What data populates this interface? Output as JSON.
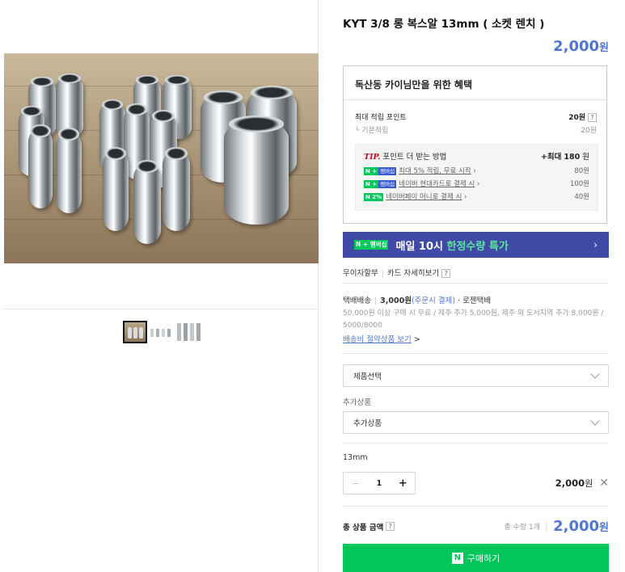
{
  "product": {
    "title": "KYT 3/8 롱 복스알 13mm ( 소켓 렌치 )",
    "price_num": "2,000",
    "price_unit": "원"
  },
  "benefits": {
    "title": "독산동 카이님만을 위한 혜택",
    "max_points_label": "최대 적립 포인트",
    "max_points_value": "20원",
    "help_glyph": "?",
    "base_label": "└ 기본적립",
    "base_value": "20원",
    "tip_prefix": "TIP.",
    "tip_title": "포인트 더 받는 방법",
    "tip_max_prefix": "+최대",
    "tip_max_value": "180",
    "tip_max_unit": "원",
    "tips": [
      {
        "badge": "N +",
        "badge2": "멤버십",
        "text": "최대 5% 적립, 무료 시작",
        "value": "80원"
      },
      {
        "badge": "N +",
        "badge2": "멤버십",
        "text": "네이버 현대카드로 결제 시",
        "value": "100원"
      },
      {
        "badge": "N 2%",
        "badge2": "",
        "text": "네이버페이 머니로 결제 시",
        "value": "40원"
      }
    ],
    "chevron": "›"
  },
  "banner": {
    "badge": "N + 멤버십",
    "text1": "매일 10시",
    "text2": "한정수량 특가",
    "arrow": "›"
  },
  "card": {
    "installment": "무이자할부",
    "card_detail": "카드 자세히보기",
    "help": "?"
  },
  "shipping": {
    "label": "택배배송",
    "fee": "3,000원",
    "fee_note": "(주문시 결제)",
    "carrier": "· 로젠택배",
    "note": "50,000원 이상 구매 시 무료 / 제주 추가 5,000원, 제주 외 도서지역 추가 8,000원 / 5000/8000",
    "saving_link": "배송비 절약상품 보기",
    "link_chevron": ">"
  },
  "options": {
    "product_select": "제품선택",
    "addon_label": "추가상품",
    "addon_select": "추가상품"
  },
  "selected": {
    "name": "13mm",
    "minus": "−",
    "qty": "1",
    "plus": "+",
    "price_num": "2,000",
    "price_unit": "원",
    "remove": "✕"
  },
  "total": {
    "label": "총 상품 금액",
    "help": "?",
    "count": "총 수량 1개",
    "divider": "|",
    "amount_num": "2,000",
    "amount_unit": "원"
  },
  "buy": {
    "logo": "N",
    "label": "구매하기"
  },
  "colors": {
    "accent_blue": "#4e76d4",
    "naver_green": "#03c75a",
    "banner_navy": "#3e4aa5"
  }
}
